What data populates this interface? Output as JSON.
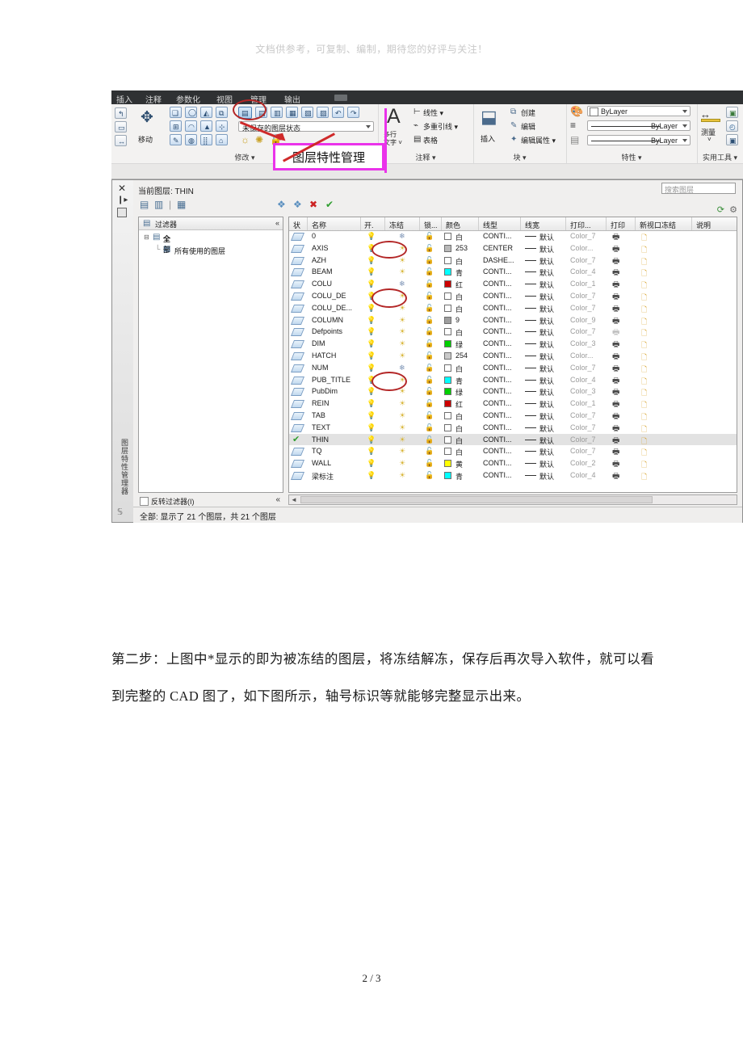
{
  "document": {
    "header_note": "文档供参考，可复制、编制，期待您的好评与关注！",
    "paragraph": "第二步：上图中*显示的即为被冻结的图层，将冻结解冻，保存后再次导入软件，就可以看到完整的 CAD 图了，如下图所示，轴号标识等就能够完整显示出来。",
    "page_number": "2 / 3"
  },
  "screenshot": {
    "menubar": {
      "items": [
        "插入",
        "注释",
        "参数化",
        "视图",
        "管理",
        "输出"
      ]
    },
    "ribbon": {
      "panels": [
        {
          "label": "修改 ▾",
          "name": "modify"
        },
        {
          "label": "注释 ▾",
          "name": "annotation"
        },
        {
          "label": "块 ▾",
          "name": "block"
        },
        {
          "label": "特性 ▾",
          "name": "properties"
        },
        {
          "label": "实用工具 ▾",
          "name": "utilities"
        }
      ],
      "modify": {
        "move_label": "移动",
        "layer_state_combo": "未保存的图层状态"
      },
      "annotation": {
        "multiline_text_label": "多行\n文字",
        "items": [
          "线性",
          "多重引线",
          "表格"
        ],
        "linear_label": "线性 ▾",
        "leader_label": "多重引线 ▾",
        "table_label": "表格"
      },
      "block": {
        "insert_label": "插入",
        "create_label": "创建",
        "edit_label": "编辑",
        "edit_attr_label": "编辑属性 ▾"
      },
      "properties": {
        "color_value": "ByLayer",
        "linetype_value": "ByLayer",
        "lineweight_value": "ByLayer"
      },
      "utilities": {
        "measure_label": "测量"
      }
    },
    "annotation_callout": {
      "label": "图层特性管理",
      "box_color": "#ea33ea",
      "circle_color": "#b32626"
    },
    "layer_palette": {
      "vertical_title": "图层特性管理器",
      "current_layer_text": "当前图层: THIN",
      "search_placeholder": "搜索图层",
      "filter_panel": {
        "title": "过滤器",
        "collapse": "«",
        "tree": [
          "全部",
          "所有使用的图层"
        ],
        "invert_filter_label": "反转过滤器(I)"
      },
      "columns": [
        "状",
        "名称",
        "开.",
        "冻结",
        "锁...",
        "颜色",
        "线型",
        "线宽",
        "打印...",
        "打印",
        "新视口冻结",
        "说明"
      ],
      "status_text": "全部: 显示了 21 个图层，共 21 个图层",
      "rows": [
        {
          "status": "normal",
          "name": "0",
          "on": true,
          "frozen": true,
          "lock": false,
          "color_name": "白",
          "color_hex": "#ffffff",
          "linetype": "CONTI...",
          "lineweight": "默认",
          "plotstyle": "Color_7",
          "plot": true,
          "vpfreeze": true,
          "desc": "",
          "selected": false,
          "circled": true
        },
        {
          "status": "normal",
          "name": "AXIS",
          "on": true,
          "frozen": false,
          "lock": false,
          "color_name": "253",
          "color_hex": "#b9b9b9",
          "linetype": "CENTER",
          "lineweight": "默认",
          "plotstyle": "Color...",
          "plot": true,
          "vpfreeze": true,
          "desc": "",
          "selected": false,
          "circled": false
        },
        {
          "status": "normal",
          "name": "AZH",
          "on": true,
          "frozen": false,
          "lock": false,
          "color_name": "白",
          "color_hex": "#ffffff",
          "linetype": "DASHE...",
          "lineweight": "默认",
          "plotstyle": "Color_7",
          "plot": true,
          "vpfreeze": true,
          "desc": "",
          "selected": false,
          "circled": false
        },
        {
          "status": "normal",
          "name": "BEAM",
          "on": true,
          "frozen": false,
          "lock": false,
          "color_name": "青",
          "color_hex": "#00ffff",
          "linetype": "CONTI...",
          "lineweight": "默认",
          "plotstyle": "Color_4",
          "plot": true,
          "vpfreeze": true,
          "desc": "",
          "selected": false,
          "circled": false
        },
        {
          "status": "normal",
          "name": "COLU",
          "on": true,
          "frozen": true,
          "lock": false,
          "color_name": "红",
          "color_hex": "#cc0000",
          "linetype": "CONTI...",
          "lineweight": "默认",
          "plotstyle": "Color_1",
          "plot": true,
          "vpfreeze": true,
          "desc": "",
          "selected": false,
          "circled": true
        },
        {
          "status": "normal",
          "name": "COLU_DE",
          "on": true,
          "frozen": false,
          "lock": false,
          "color_name": "白",
          "color_hex": "#ffffff",
          "linetype": "CONTI...",
          "lineweight": "默认",
          "plotstyle": "Color_7",
          "plot": true,
          "vpfreeze": true,
          "desc": "",
          "selected": false,
          "circled": false
        },
        {
          "status": "normal",
          "name": "COLU_DE...",
          "on": true,
          "frozen": false,
          "lock": false,
          "color_name": "白",
          "color_hex": "#ffffff",
          "linetype": "CONTI...",
          "lineweight": "默认",
          "plotstyle": "Color_7",
          "plot": true,
          "vpfreeze": true,
          "desc": "",
          "selected": false,
          "circled": false
        },
        {
          "status": "normal",
          "name": "COLUMN",
          "on": true,
          "frozen": false,
          "lock": false,
          "color_name": "9",
          "color_hex": "#9e9e9e",
          "linetype": "CONTI...",
          "lineweight": "默认",
          "plotstyle": "Color_9",
          "plot": true,
          "vpfreeze": true,
          "desc": "",
          "selected": false,
          "circled": false
        },
        {
          "status": "normal",
          "name": "Defpoints",
          "on": true,
          "frozen": false,
          "lock": false,
          "color_name": "白",
          "color_hex": "#ffffff",
          "linetype": "CONTI...",
          "lineweight": "默认",
          "plotstyle": "Color_7",
          "plot": false,
          "vpfreeze": true,
          "desc": "",
          "selected": false,
          "circled": false
        },
        {
          "status": "normal",
          "name": "DIM",
          "on": true,
          "frozen": false,
          "lock": false,
          "color_name": "绿",
          "color_hex": "#00d000",
          "linetype": "CONTI...",
          "lineweight": "默认",
          "plotstyle": "Color_3",
          "plot": true,
          "vpfreeze": true,
          "desc": "",
          "selected": false,
          "circled": false
        },
        {
          "status": "normal",
          "name": "HATCH",
          "on": true,
          "frozen": false,
          "lock": false,
          "color_name": "254",
          "color_hex": "#c9c9c9",
          "linetype": "CONTI...",
          "lineweight": "默认",
          "plotstyle": "Color...",
          "plot": true,
          "vpfreeze": true,
          "desc": "",
          "selected": false,
          "circled": false
        },
        {
          "status": "normal",
          "name": "NUM",
          "on": true,
          "frozen": true,
          "lock": false,
          "color_name": "白",
          "color_hex": "#ffffff",
          "linetype": "CONTI...",
          "lineweight": "默认",
          "plotstyle": "Color_7",
          "plot": true,
          "vpfreeze": true,
          "desc": "",
          "selected": false,
          "circled": true
        },
        {
          "status": "normal",
          "name": "PUB_TITLE",
          "on": true,
          "frozen": false,
          "lock": false,
          "color_name": "青",
          "color_hex": "#00ffff",
          "linetype": "CONTI...",
          "lineweight": "默认",
          "plotstyle": "Color_4",
          "plot": true,
          "vpfreeze": true,
          "desc": "",
          "selected": false,
          "circled": false
        },
        {
          "status": "normal",
          "name": "PubDim",
          "on": true,
          "frozen": false,
          "lock": false,
          "color_name": "绿",
          "color_hex": "#00d000",
          "linetype": "CONTI...",
          "lineweight": "默认",
          "plotstyle": "Color_3",
          "plot": true,
          "vpfreeze": true,
          "desc": "",
          "selected": false,
          "circled": false
        },
        {
          "status": "normal",
          "name": "REIN",
          "on": true,
          "frozen": false,
          "lock": false,
          "color_name": "红",
          "color_hex": "#cc0000",
          "linetype": "CONTI...",
          "lineweight": "默认",
          "plotstyle": "Color_1",
          "plot": true,
          "vpfreeze": true,
          "desc": "",
          "selected": false,
          "circled": false
        },
        {
          "status": "normal",
          "name": "TAB",
          "on": true,
          "frozen": false,
          "lock": false,
          "color_name": "白",
          "color_hex": "#ffffff",
          "linetype": "CONTI...",
          "lineweight": "默认",
          "plotstyle": "Color_7",
          "plot": true,
          "vpfreeze": true,
          "desc": "",
          "selected": false,
          "circled": false
        },
        {
          "status": "normal",
          "name": "TEXT",
          "on": true,
          "frozen": false,
          "lock": false,
          "color_name": "白",
          "color_hex": "#ffffff",
          "linetype": "CONTI...",
          "lineweight": "默认",
          "plotstyle": "Color_7",
          "plot": true,
          "vpfreeze": true,
          "desc": "",
          "selected": false,
          "circled": false
        },
        {
          "status": "current",
          "name": "THIN",
          "on": true,
          "frozen": false,
          "lock": false,
          "color_name": "白",
          "color_hex": "#ffffff",
          "linetype": "CONTI...",
          "lineweight": "默认",
          "plotstyle": "Color_7",
          "plot": true,
          "vpfreeze": true,
          "desc": "",
          "selected": true,
          "circled": false
        },
        {
          "status": "normal",
          "name": "TQ",
          "on": true,
          "frozen": false,
          "lock": false,
          "color_name": "白",
          "color_hex": "#ffffff",
          "linetype": "CONTI...",
          "lineweight": "默认",
          "plotstyle": "Color_7",
          "plot": true,
          "vpfreeze": true,
          "desc": "",
          "selected": false,
          "circled": false
        },
        {
          "status": "normal",
          "name": "WALL",
          "on": true,
          "frozen": false,
          "lock": false,
          "color_name": "黄",
          "color_hex": "#ffff00",
          "linetype": "CONTI...",
          "lineweight": "默认",
          "plotstyle": "Color_2",
          "plot": true,
          "vpfreeze": true,
          "desc": "",
          "selected": false,
          "circled": false
        },
        {
          "status": "normal",
          "name": "梁标注",
          "on": true,
          "frozen": false,
          "lock": false,
          "color_name": "青",
          "color_hex": "#00ffff",
          "linetype": "CONTI...",
          "lineweight": "默认",
          "plotstyle": "Color_4",
          "plot": true,
          "vpfreeze": true,
          "desc": "",
          "selected": false,
          "circled": false
        }
      ]
    }
  }
}
